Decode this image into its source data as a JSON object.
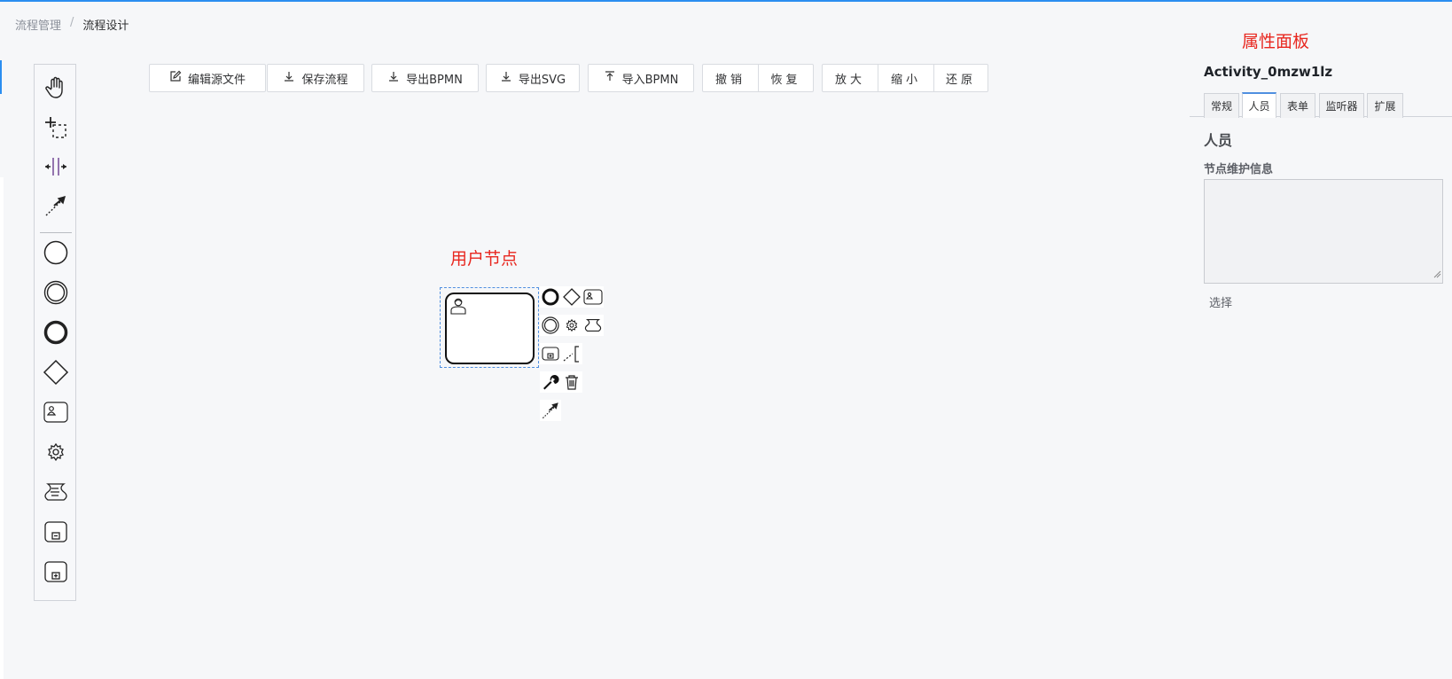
{
  "breadcrumb": {
    "parent": "流程管理",
    "separator": "/",
    "current": "流程设计"
  },
  "toolbar": {
    "edit_source": "编辑源文件",
    "save_flow": "保存流程",
    "export_bpmn": "导出BPMN",
    "export_svg": "导出SVG",
    "import_bpmn": "导入BPMN",
    "undo": "撤销",
    "redo": "恢复",
    "zoom_in": "放大",
    "zoom_out": "缩小",
    "reset": "还原"
  },
  "palette": {
    "tools": [
      "hand-tool",
      "lasso-tool",
      "space-tool",
      "global-connect-tool"
    ],
    "shapes": [
      "start-event",
      "intermediate-event",
      "end-event",
      "exclusive-gateway",
      "user-task",
      "service-task",
      "script-task",
      "collapsed-subprocess",
      "expanded-subprocess"
    ]
  },
  "annotations": {
    "user_node": "用户节点",
    "properties_panel": "属性面板"
  },
  "properties": {
    "element_id": "Activity_0mzw1lz",
    "tabs": [
      "常规",
      "人员",
      "表单",
      "监听器",
      "扩展"
    ],
    "active_tab": "人员",
    "section_title": "人员",
    "field_label": "节点维护信息",
    "field_value": "",
    "select_label": "选择"
  },
  "colors": {
    "accent": "#2b8ef0",
    "annotation": "#e8271f",
    "selection": "#4f8fe0"
  }
}
